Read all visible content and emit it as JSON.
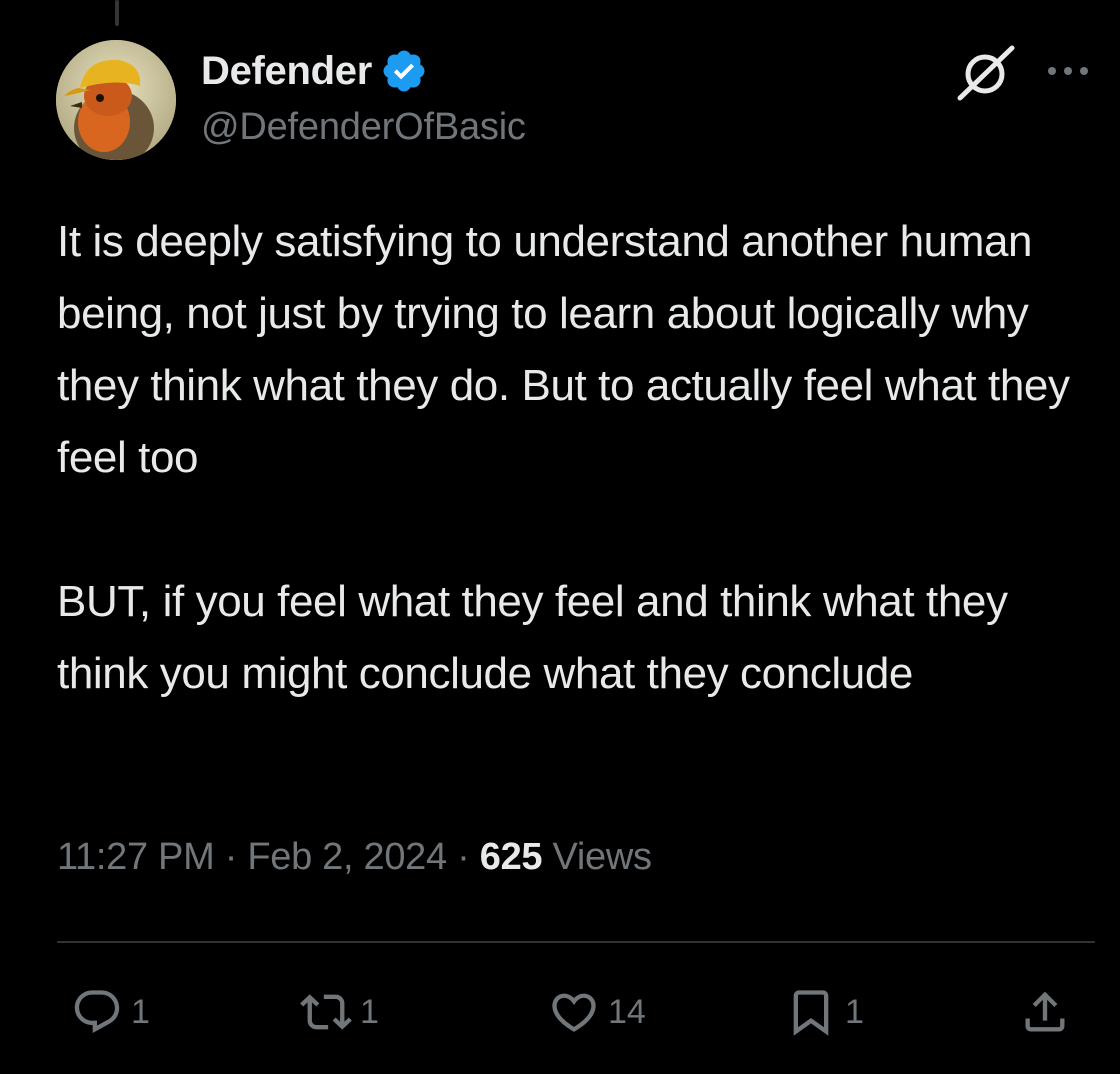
{
  "author": {
    "display_name": "Defender",
    "handle": "@DefenderOfBasic",
    "verified": true,
    "verified_color": "#1d9bf0"
  },
  "icons": {
    "grok": "grok-icon",
    "more": "more-options-icon"
  },
  "tweet": {
    "text": "It is deeply satisfying to understand another human being, not just by trying to learn about logically why they think what they do. But to actually feel what they feel too\n\nBUT, if you feel what they feel and think what they think you might conclude what they conclude"
  },
  "meta": {
    "time": "11:27 PM",
    "separator": "·",
    "date": "Feb 2, 2024",
    "views_count": "625",
    "views_label": "Views"
  },
  "actions": {
    "replies": "1",
    "reposts": "1",
    "likes": "14",
    "bookmarks": "1"
  },
  "colors": {
    "background": "#000000",
    "text_primary": "#e7e9ea",
    "text_secondary": "#71767b",
    "divider": "#2f3336"
  }
}
